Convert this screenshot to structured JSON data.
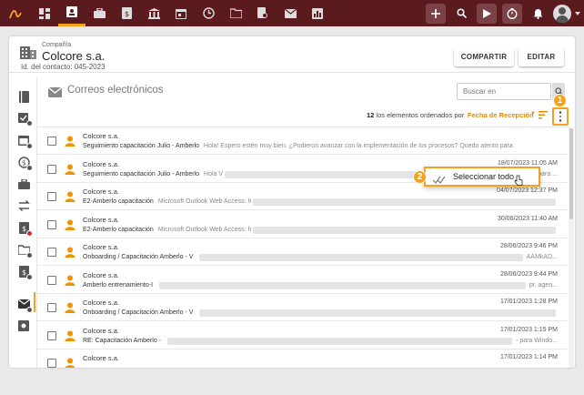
{
  "company": {
    "label": "Compañía",
    "name": "Colcore s.a.",
    "contact_id": "Id. del contacto: 045-2023"
  },
  "actions": {
    "share": "COMPARTIR",
    "edit": "EDITAR"
  },
  "section": {
    "title": "Correos electrónicos"
  },
  "search": {
    "placeholder": "Buscar en"
  },
  "sort": {
    "count": "12",
    "count_suffix": " los elementos ordenados por",
    "field": "Fecha de Recepción"
  },
  "dropdown": {
    "select_all": "Seleccionar todo"
  },
  "callouts": [
    "1",
    "2"
  ],
  "colors": {
    "brand": "#5a1a1e",
    "accent": "#f5a11c",
    "person": "#f39200"
  },
  "emails": [
    {
      "from": "Colcore s.a.",
      "subject": "Seguimiento capacitación Julio - Amberlo",
      "preview": "Hola! Espero estén muy bien. ¿Pudieron avanzar con la implementación de los procesos? Quedo atento para",
      "date": "",
      "tail": ""
    },
    {
      "from": "Colcore s.a.",
      "subject": "Seguimiento capacitación Julio - Amberlo",
      "preview": "Hola V",
      "date": "18/07/2023 11:05 AM",
      "tail": "? Quedo atento para ..."
    },
    {
      "from": "Colcore s.a.",
      "subject": "E2-Amberlo capacitación",
      "preview": "Microsoft Outlook Web Access: h",
      "date": "04/07/2023 12:37 PM",
      "tail": ""
    },
    {
      "from": "Colcore s.a.",
      "subject": "E2-Amberlo capacitación",
      "preview": "Microsoft Outlook Web Access: h",
      "date": "30/06/2023 11:40 AM",
      "tail": ""
    },
    {
      "from": "Colcore s.a.",
      "subject": "Onboarding / Capacitación Amberlo - V",
      "preview": "",
      "date": "28/06/2023 9:46 PM",
      "tail": "AAMkAD..."
    },
    {
      "from": "Colcore s.a.",
      "subject": "Amberlo entrenamiento-I",
      "preview": "",
      "date": "28/06/2023 9:44 PM",
      "tail": "pr. agen..."
    },
    {
      "from": "Colcore s.a.",
      "subject": "Onboarding / Capacitación Amberlo - V",
      "preview": "",
      "date": "17/01/2023 1:28 PM",
      "tail": ""
    },
    {
      "from": "Colcore s.a.",
      "subject": "RE: Capacitación Amberlo -",
      "preview": "",
      "date": "17/01/2023 1:15 PM",
      "tail": "- para Windo..."
    },
    {
      "from": "Colcore s.a.",
      "subject": "",
      "preview": "",
      "date": "17/01/2023 1:14 PM",
      "tail": ""
    }
  ]
}
